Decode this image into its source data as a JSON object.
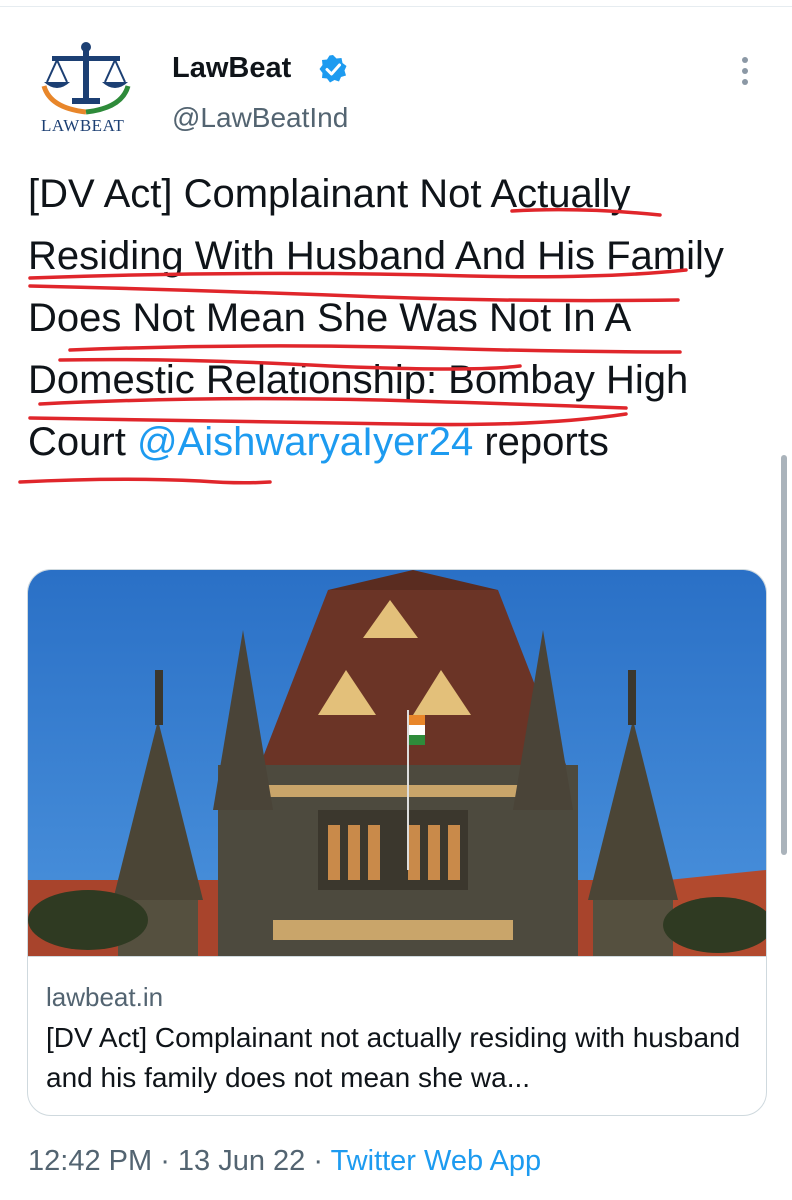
{
  "account": {
    "name": "LawBeat",
    "handle": "@LawBeatInd",
    "logo_text": "LawBeat",
    "logo_text_display": "LAWBEAT",
    "verified_icon": "verified-badge-icon",
    "more_icon": "more-vertical-icon"
  },
  "tweet": {
    "text": "[DV Act] Complainant Not Actually Residing With Husband And His Family Does Not Mean She Was Not In A Domestic Relationship: Bombay High Court",
    "mention": "@AishwaryaIyer24",
    "suffix": " reports"
  },
  "card": {
    "image_subject": "Bombay High Court building",
    "domain": "lawbeat.in",
    "title": "[DV Act] Complainant not actually residing with husband and his family does not mean she wa..."
  },
  "meta": {
    "time": "12:42 PM",
    "separator": " · ",
    "date": "13 Jun 22",
    "source": "Twitter Web App"
  },
  "colors": {
    "link": "#1d9bf0",
    "secondary_text": "#536471",
    "ink_annotation": "#e0262b",
    "logo_blue": "#1c3f73",
    "logo_orange": "#e8862a",
    "logo_green": "#2e8b3a"
  }
}
